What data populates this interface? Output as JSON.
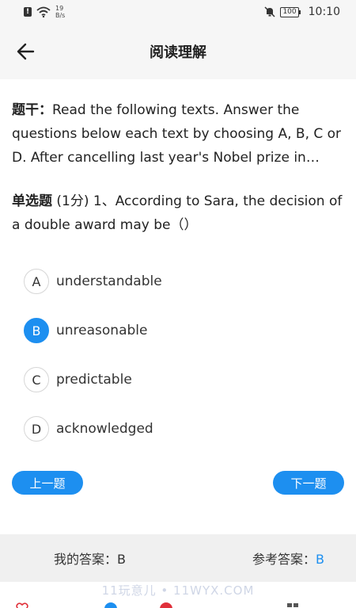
{
  "status_bar": {
    "net_speed_value": "19",
    "net_speed_unit": "B/s",
    "battery": "100",
    "time": "10:10"
  },
  "header": {
    "title": "阅读理解"
  },
  "stem": {
    "label": "题干：",
    "text": "Read the following texts. Answer the questions below each text by choosing A, B, C or D. After cancelling last year's Nobel prize in literature, the Swedish Academy announced it would award two prizes this year."
  },
  "question": {
    "type_label": "单选题",
    "score": " (1分) ",
    "text": "1、According to Sara, the decision of a double award may be（）"
  },
  "options": [
    {
      "letter": "A",
      "text": "understandable",
      "selected": false
    },
    {
      "letter": "B",
      "text": "unreasonable",
      "selected": true
    },
    {
      "letter": "C",
      "text": "predictable",
      "selected": false
    },
    {
      "letter": "D",
      "text": "acknowledged",
      "selected": false
    }
  ],
  "nav": {
    "prev_label": "上一题",
    "next_label": "下一题"
  },
  "answer": {
    "my_label": "我的答案：",
    "my_value": "B",
    "ref_label": "参考答案：",
    "ref_value": "B"
  },
  "watermark": "11玩意儿 • 11WYX.COM",
  "colors": {
    "accent": "#1d8ff0",
    "favorite": "#e0303a"
  }
}
